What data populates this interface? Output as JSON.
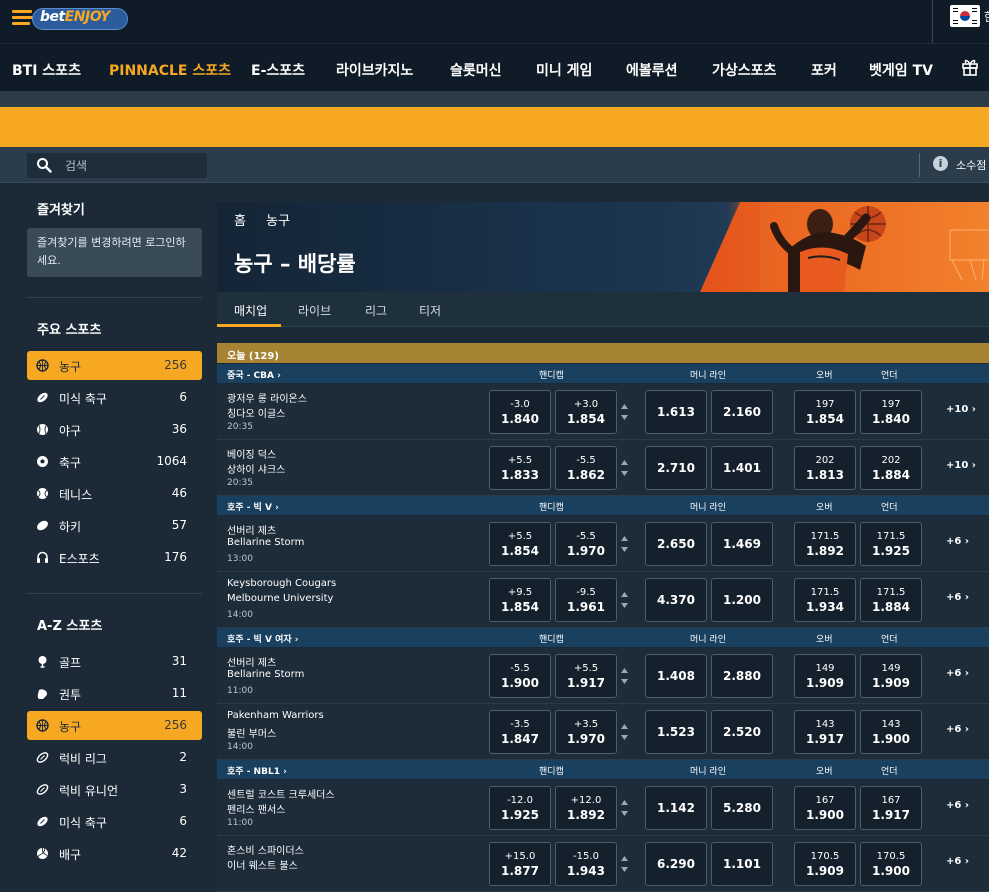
{
  "header": {
    "logo_text_main": "bet",
    "logo_text_accent": "ENJOY",
    "lang_label": "한"
  },
  "nav": [
    "BTI 스포츠",
    "PINNACLE 스포츠",
    "E-스포츠",
    "라이브카지노",
    "슬롯머신",
    "미니 게임",
    "에볼루션",
    "가상스포츠",
    "포커",
    "벳게임 TV"
  ],
  "search": {
    "placeholder": "검색",
    "decimal_label": "소수점"
  },
  "sidebar": {
    "fav_title": "즐겨찾기",
    "fav_message": "즐겨찾기를 변경하려면 로그인하세요.",
    "main_title": "주요 스포츠",
    "main_items": [
      {
        "label": "농구",
        "count": "256",
        "icon": "basketball-icon"
      },
      {
        "label": "미식 축구",
        "count": "6",
        "icon": "american-football-icon"
      },
      {
        "label": "야구",
        "count": "36",
        "icon": "baseball-icon"
      },
      {
        "label": "축구",
        "count": "1064",
        "icon": "soccer-icon"
      },
      {
        "label": "테니스",
        "count": "46",
        "icon": "tennis-icon"
      },
      {
        "label": "하키",
        "count": "57",
        "icon": "hockey-icon"
      },
      {
        "label": "E스포츠",
        "count": "176",
        "icon": "headset-icon"
      }
    ],
    "az_title": "A-Z 스포츠",
    "az_items": [
      {
        "label": "골프",
        "count": "31",
        "icon": "golf-icon"
      },
      {
        "label": "권투",
        "count": "11",
        "icon": "boxing-icon"
      },
      {
        "label": "농구",
        "count": "256",
        "icon": "basketball-icon"
      },
      {
        "label": "럭비 리그",
        "count": "2",
        "icon": "rugby-icon"
      },
      {
        "label": "럭비 유니언",
        "count": "3",
        "icon": "rugby-icon"
      },
      {
        "label": "미식 축구",
        "count": "6",
        "icon": "american-football-icon"
      },
      {
        "label": "배구",
        "count": "42",
        "icon": "volleyball-icon"
      }
    ]
  },
  "main": {
    "breadcrumb": [
      "홈",
      "농구"
    ],
    "title": "농구 – 배당률",
    "tabs": [
      "매치업",
      "라이브",
      "리그",
      "티저"
    ],
    "today_label": "오늘 (129)",
    "col_headers": {
      "handicap": "핸디캡",
      "moneyline": "머니 라인",
      "over": "오버",
      "under": "언더"
    },
    "leagues": [
      {
        "name": "중국 - CBA",
        "matches": [
          {
            "team1": "광저우 롱 라이온스",
            "team2": "칭다오 이글스",
            "time": "20:35",
            "hcp1": {
              "line": "-3.0",
              "price": "1.840"
            },
            "hcp2": {
              "line": "+3.0",
              "price": "1.854"
            },
            "ml1": "1.613",
            "ml2": "2.160",
            "over": {
              "line": "197",
              "price": "1.854"
            },
            "under": {
              "line": "197",
              "price": "1.840"
            },
            "more": "+10"
          },
          {
            "team1": "베이징 덕스",
            "team2": "상하이 샤크스",
            "time": "20:35",
            "hcp1": {
              "line": "+5.5",
              "price": "1.833"
            },
            "hcp2": {
              "line": "-5.5",
              "price": "1.862"
            },
            "ml1": "2.710",
            "ml2": "1.401",
            "over": {
              "line": "202",
              "price": "1.813"
            },
            "under": {
              "line": "202",
              "price": "1.884"
            },
            "more": "+10"
          }
        ]
      },
      {
        "name": "호주 - 빅 V",
        "matches": [
          {
            "team1": "선버리 제츠",
            "team2": "Bellarine Storm",
            "time": "13:00",
            "hcp1": {
              "line": "+5.5",
              "price": "1.854"
            },
            "hcp2": {
              "line": "-5.5",
              "price": "1.970"
            },
            "ml1": "2.650",
            "ml2": "1.469",
            "over": {
              "line": "171.5",
              "price": "1.892"
            },
            "under": {
              "line": "171.5",
              "price": "1.925"
            },
            "more": "+6"
          },
          {
            "team1": "Keysborough Cougars",
            "team2": "Melbourne University",
            "time": "14:00",
            "hcp1": {
              "line": "+9.5",
              "price": "1.854"
            },
            "hcp2": {
              "line": "-9.5",
              "price": "1.961"
            },
            "ml1": "4.370",
            "ml2": "1.200",
            "over": {
              "line": "171.5",
              "price": "1.934"
            },
            "under": {
              "line": "171.5",
              "price": "1.884"
            },
            "more": "+6"
          }
        ]
      },
      {
        "name": "호주 - 빅 V 여자",
        "matches": [
          {
            "team1": "선버리 제츠",
            "team2": "Bellarine Storm",
            "time": "11:00",
            "hcp1": {
              "line": "-5.5",
              "price": "1.900"
            },
            "hcp2": {
              "line": "+5.5",
              "price": "1.917"
            },
            "ml1": "1.408",
            "ml2": "2.880",
            "over": {
              "line": "149",
              "price": "1.909"
            },
            "under": {
              "line": "149",
              "price": "1.909"
            },
            "more": "+6"
          },
          {
            "team1": "Pakenham Warriors",
            "team2": "불린 부머스",
            "time": "14:00",
            "hcp1": {
              "line": "-3.5",
              "price": "1.847"
            },
            "hcp2": {
              "line": "+3.5",
              "price": "1.970"
            },
            "ml1": "1.523",
            "ml2": "2.520",
            "over": {
              "line": "143",
              "price": "1.917"
            },
            "under": {
              "line": "143",
              "price": "1.900"
            },
            "more": "+6"
          }
        ]
      },
      {
        "name": "호주 - NBL1",
        "matches": [
          {
            "team1": "센트럴 코스트 크루세더스",
            "team2": "펜리스 팬서스",
            "time": "11:00",
            "hcp1": {
              "line": "-12.0",
              "price": "1.925"
            },
            "hcp2": {
              "line": "+12.0",
              "price": "1.892"
            },
            "ml1": "1.142",
            "ml2": "5.280",
            "over": {
              "line": "167",
              "price": "1.900"
            },
            "under": {
              "line": "167",
              "price": "1.917"
            },
            "more": "+6"
          },
          {
            "team1": "혼스비 스파이더스",
            "team2": "이너 웨스트 불스",
            "time": "",
            "hcp1": {
              "line": "+15.0",
              "price": "1.877"
            },
            "hcp2": {
              "line": "-15.0",
              "price": "1.943"
            },
            "ml1": "6.290",
            "ml2": "1.101",
            "over": {
              "line": "170.5",
              "price": "1.909"
            },
            "under": {
              "line": "170.5",
              "price": "1.900"
            },
            "more": "+6"
          }
        ]
      }
    ]
  },
  "colors": {
    "accent": "#f7a823",
    "nav_bg": "#0f1b26",
    "body_bg": "#1b2a36",
    "league_bar": "#1a4060",
    "today_bar": "#a68233"
  }
}
